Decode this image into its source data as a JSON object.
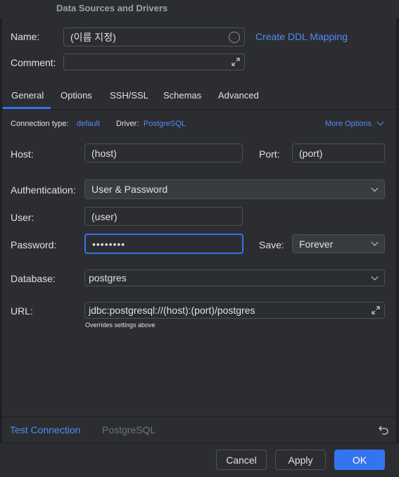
{
  "window": {
    "title": "Data Sources and Drivers"
  },
  "form": {
    "name_label": "Name:",
    "name_value": "(이름 지정)",
    "create_ddl_label": "Create DDL Mapping",
    "comment_label": "Comment:",
    "comment_value": ""
  },
  "tabs": [
    {
      "label": "General",
      "active": true
    },
    {
      "label": "Options"
    },
    {
      "label": "SSH/SSL"
    },
    {
      "label": "Schemas"
    },
    {
      "label": "Advanced"
    }
  ],
  "connection": {
    "type_label": "Connection type:",
    "type_value": "default",
    "driver_label": "Driver:",
    "driver_value": "PostgreSQL",
    "more_options_label": "More Options"
  },
  "general": {
    "host_label": "Host:",
    "host_value": "(host)",
    "port_label": "Port:",
    "port_value": "(port)",
    "auth_label": "Authentication:",
    "auth_value": "User & Password",
    "user_label": "User:",
    "user_value": "(user)",
    "password_label": "Password:",
    "password_value": "••••••••",
    "save_label": "Save:",
    "save_value": "Forever",
    "database_label": "Database:",
    "database_value": "postgres",
    "url_label": "URL:",
    "url_value": "jdbc:postgresql://(host):(port)/postgres",
    "url_hint": "Overrides settings above"
  },
  "bottom": {
    "test_connection_label": "Test Connection",
    "driver_status": "PostgreSQL"
  },
  "buttons": {
    "cancel": "Cancel",
    "apply": "Apply",
    "ok": "OK"
  },
  "colors": {
    "accent": "#3574f0",
    "link": "#548af7",
    "background": "#2b2d30"
  }
}
